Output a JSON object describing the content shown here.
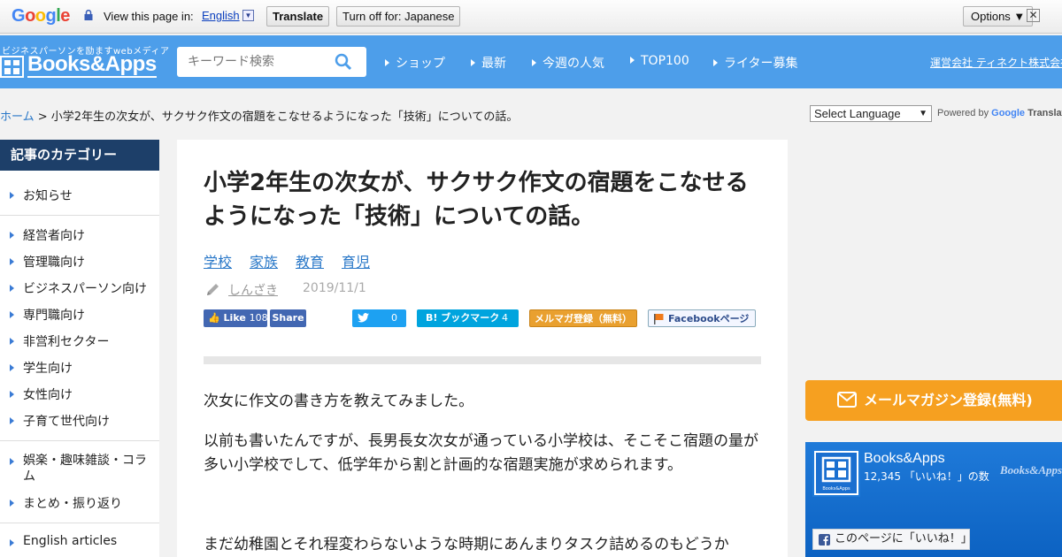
{
  "translate_bar": {
    "logo": "Google",
    "view_text": "View this page in:",
    "language": "English",
    "translate_label": "Translate",
    "turn_off_label": "Turn off for: Japanese",
    "options_label": "Options ▼",
    "close_label": "✕"
  },
  "header": {
    "tagline": "ビジネスパーソンを励ますwebメディア",
    "logo_text": "Books&Apps",
    "search_placeholder": "キーワード検索",
    "nav": [
      "ショップ",
      "最新",
      "今週の人気",
      "TOP100",
      "ライター募集"
    ],
    "company_link": "運営会社 ティネクト株式会社"
  },
  "breadcrumb": {
    "home": "ホーム",
    "separator": " > ",
    "current": "小学2年生の次女が、サクサク作文の宿題をこなせるようになった「技術」についての話。"
  },
  "language_widget": {
    "select_label": "Select Language",
    "powered_by": "Powered by",
    "google": "Google",
    "translate": "Translate"
  },
  "sidebar": {
    "heading": "記事のカテゴリー",
    "items": [
      "お知らせ",
      "経営者向け",
      "管理職向け",
      "ビジネスパーソン向け",
      "専門職向け",
      "非営利セクター",
      "学生向け",
      "女性向け",
      "子育て世代向け",
      "娯楽・趣味雑談・コラム",
      "まとめ・振り返り",
      "English articles"
    ]
  },
  "article": {
    "title": "小学2年生の次女が、サクサク作文の宿題をこなせるようになった「技術」についての話。",
    "tags": [
      "学校",
      "家族",
      "教育",
      "育児"
    ],
    "author": "しんざき",
    "date": "2019/11/1",
    "share": {
      "like_label": "Like",
      "like_count": "108",
      "share_label": "Share",
      "tweet_count": "0",
      "hatena_label": "B! ブックマーク",
      "hatena_count": "4",
      "mailmag_label": "メルマガ登録（無料）",
      "facebook_page_label": "Facebookページ"
    },
    "paragraphs": [
      "次女に作文の書き方を教えてみました。",
      "以前も書いたんですが、長男長女次女が通っている小学校は、そこそこ宿題の量が多い小学校でして、低学年から割と計画的な宿題実施が求められます。",
      "まだ幼稚園とそれ程変わらないような時期にあんまりタスク詰めるのもどうか"
    ]
  },
  "right": {
    "mail_button": "メールマガジン登録(無料)",
    "fb_page_name": "Books&Apps",
    "fb_count_text": "12,345 「いいね！」の数",
    "fb_watermark": "Books&Apps",
    "fb_like_button": "このページに「いいね！」",
    "fb_logo_caption": "Books&Apps"
  },
  "colors": {
    "header_blue": "#4d9eea",
    "sidebar_navy": "#1d3f69",
    "link_blue": "#2a78c8",
    "mail_orange": "#f6a020",
    "facebook_blue": "#3b5998",
    "twitter_blue": "#1da1f2",
    "hatena_blue": "#00a4de",
    "mailmag_orange": "#e9a02f"
  }
}
